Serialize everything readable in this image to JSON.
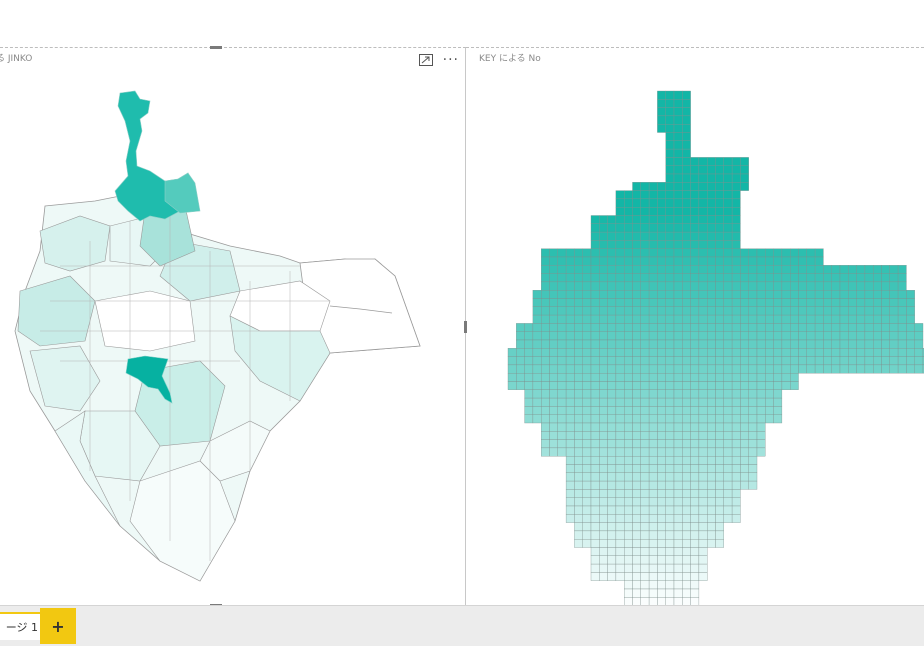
{
  "visuals": [
    {
      "title": "る JINKO",
      "type": "filled-map",
      "icons": [
        "focus-mode-icon",
        "more-options-icon"
      ],
      "more_label": "···"
    },
    {
      "title": "KEY による No",
      "type": "grid-map"
    }
  ],
  "colors": {
    "high": "#13b6a6",
    "low": "#ffffff",
    "border": "#a9a9a9",
    "accent": "#f2c811"
  },
  "pages": {
    "tabs": [
      {
        "label": "ージ 1",
        "active": true
      }
    ],
    "add_label": "+"
  }
}
